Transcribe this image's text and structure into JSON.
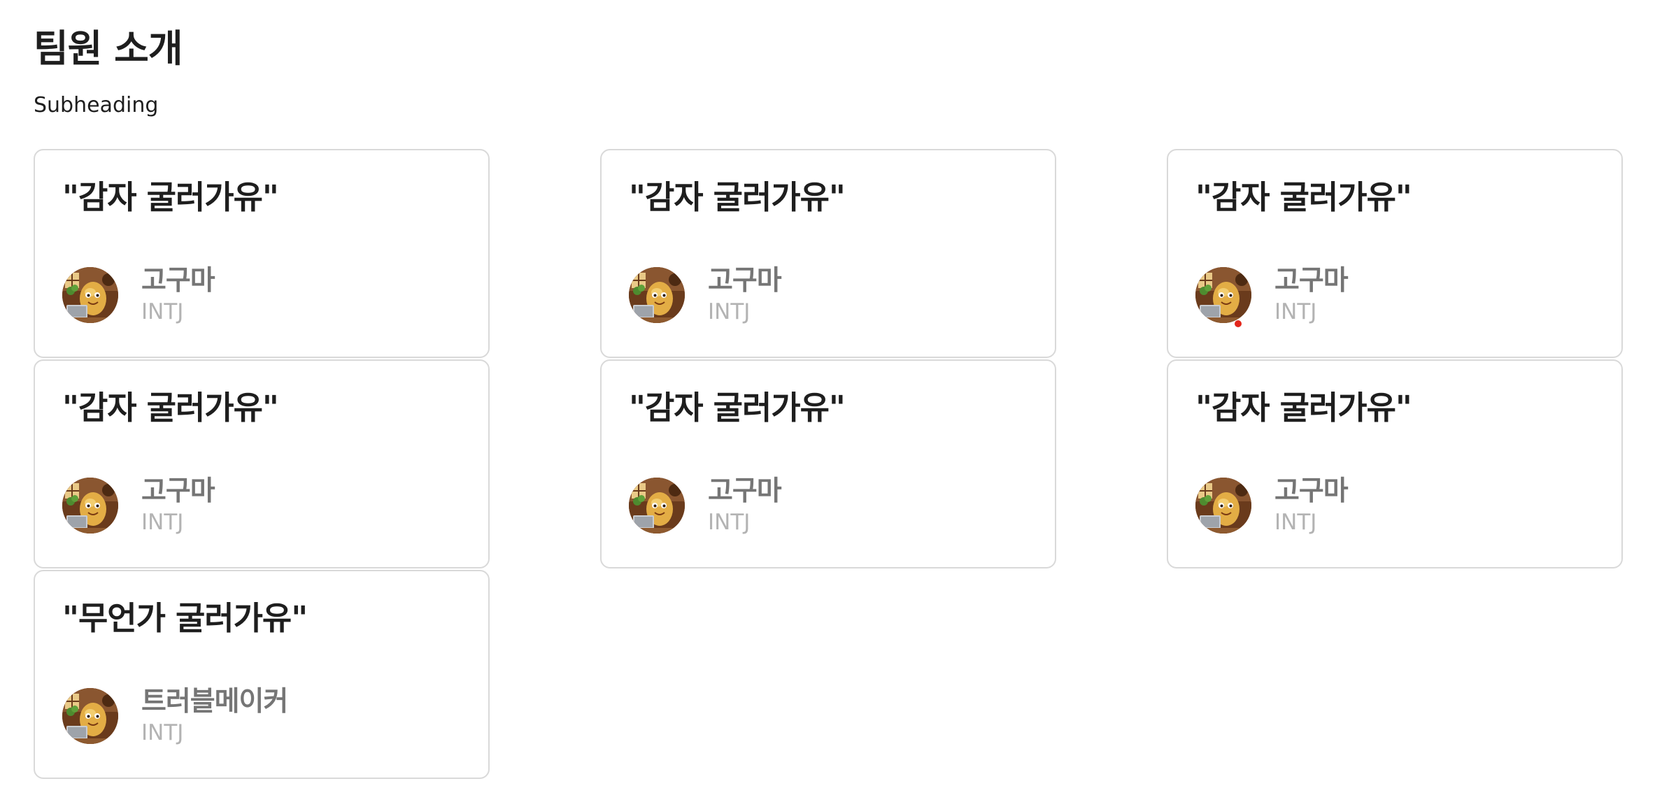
{
  "page": {
    "title": "팀원 소개",
    "subheading": "Subheading"
  },
  "members": [
    {
      "quote": "\"감자 굴러가유\"",
      "name": "고구마",
      "mbti": "INTJ",
      "avatar_icon": "potato-avatar-icon",
      "status_dot": false
    },
    {
      "quote": "\"감자 굴러가유\"",
      "name": "고구마",
      "mbti": "INTJ",
      "avatar_icon": "potato-avatar-icon",
      "status_dot": false
    },
    {
      "quote": "\"감자 굴러가유\"",
      "name": "고구마",
      "mbti": "INTJ",
      "avatar_icon": "potato-avatar-icon",
      "status_dot": true
    },
    {
      "quote": "\"감자 굴러가유\"",
      "name": "고구마",
      "mbti": "INTJ",
      "avatar_icon": "potato-avatar-icon",
      "status_dot": false
    },
    {
      "quote": "\"감자 굴러가유\"",
      "name": "고구마",
      "mbti": "INTJ",
      "avatar_icon": "potato-avatar-icon",
      "status_dot": false
    },
    {
      "quote": "\"감자 굴러가유\"",
      "name": "고구마",
      "mbti": "INTJ",
      "avatar_icon": "potato-avatar-icon",
      "status_dot": false
    },
    {
      "quote": "\"무언가 굴러가유\"",
      "name": "트러블메이커",
      "mbti": "INTJ",
      "avatar_icon": "potato-avatar-icon",
      "status_dot": false
    }
  ],
  "colors": {
    "title_text": "#1e1e1e",
    "name_text": "#757575",
    "mbti_text": "#b3b3b3",
    "card_border": "#d9d9d9",
    "status_dot": "#e3261b"
  }
}
